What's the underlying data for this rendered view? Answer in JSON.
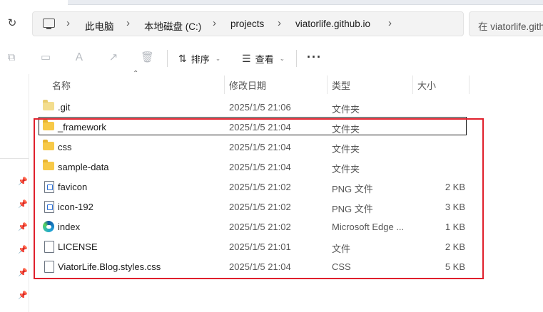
{
  "address": {
    "crumbs": [
      "此电脑",
      "本地磁盘 (C:)",
      "projects",
      "viatorlife.github.io"
    ],
    "search_placeholder": "在 viatorlife.githu"
  },
  "toolbar": {
    "sort_label": "排序",
    "view_label": "查看",
    "more_label": "···"
  },
  "columns": {
    "name": "名称",
    "date": "修改日期",
    "type": "类型",
    "size": "大小"
  },
  "files": [
    {
      "name": ".git",
      "date": "2025/1/5 21:06",
      "type": "文件夹",
      "size": "",
      "icon": "folder-pale-icon"
    },
    {
      "name": "_framework",
      "date": "2025/1/5 21:04",
      "type": "文件夹",
      "size": "",
      "icon": "folder-icon"
    },
    {
      "name": "css",
      "date": "2025/1/5 21:04",
      "type": "文件夹",
      "size": "",
      "icon": "folder-icon"
    },
    {
      "name": "sample-data",
      "date": "2025/1/5 21:04",
      "type": "文件夹",
      "size": "",
      "icon": "folder-icon"
    },
    {
      "name": "favicon",
      "date": "2025/1/5 21:02",
      "type": "PNG 文件",
      "size": "2 KB",
      "icon": "png-file-icon"
    },
    {
      "name": "icon-192",
      "date": "2025/1/5 21:02",
      "type": "PNG 文件",
      "size": "3 KB",
      "icon": "png-file-icon"
    },
    {
      "name": "index",
      "date": "2025/1/5 21:02",
      "type": "Microsoft Edge ...",
      "size": "1 KB",
      "icon": "edge-icon"
    },
    {
      "name": "LICENSE",
      "date": "2025/1/5 21:01",
      "type": "文件",
      "size": "2 KB",
      "icon": "file-icon"
    },
    {
      "name": "ViatorLife.Blog.styles.css",
      "date": "2025/1/5 21:04",
      "type": "CSS",
      "size": "5 KB",
      "icon": "file-icon"
    }
  ],
  "colors": {
    "highlight": "#e0202c",
    "folder": "#f7c948"
  }
}
